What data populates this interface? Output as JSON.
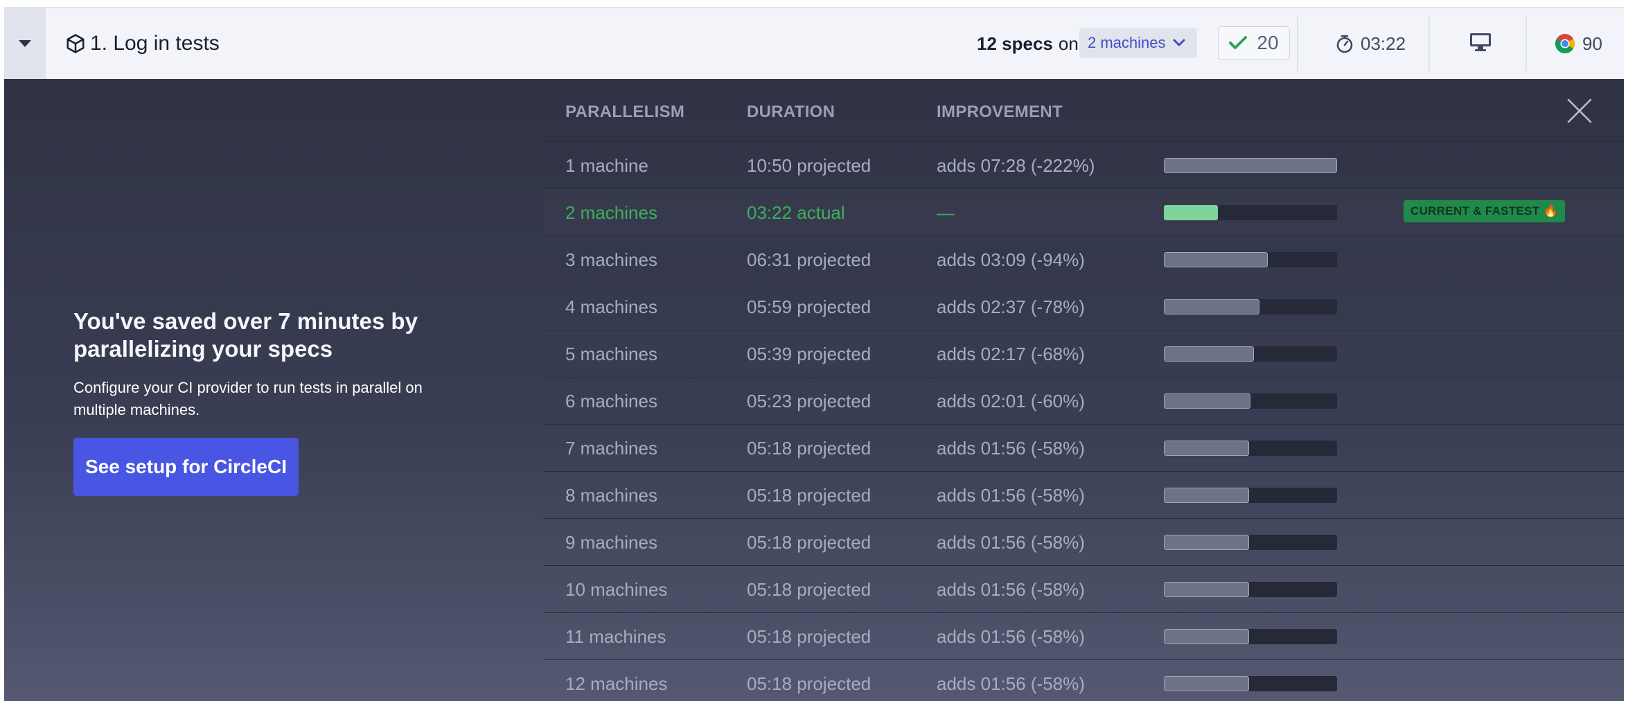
{
  "header": {
    "title": "1. Log in tests",
    "specs_count": "12 specs",
    "specs_on": "on",
    "machines_label": "2 machines",
    "passed_count": "20",
    "duration": "03:22",
    "browser_version": "90",
    "icons": {
      "toggle": "caret-down-icon",
      "spec": "cube-icon",
      "machines": "chevron-down-icon",
      "passed": "check-icon",
      "duration": "stopwatch-icon",
      "os": "monitor-icon",
      "browser": "chrome-icon"
    },
    "colors": {
      "accent": "#3e4fc2",
      "pass": "#2fa64f"
    }
  },
  "promo": {
    "heading": "You've saved over 7 minutes by parallelizing your specs",
    "text": "Configure your CI provider to run tests in parallel on multiple machines.",
    "button_label": "See setup for CircleCI",
    "button_color": "#4956e3"
  },
  "table": {
    "columns": [
      "PARALLELISM",
      "DURATION",
      "IMPROVEMENT"
    ],
    "close_icon": "close-icon",
    "badge": "CURRENT & FASTEST 🔥",
    "rows": [
      {
        "parallelism": "1 machine",
        "duration": "10:50 projected",
        "improvement": "adds 07:28 (-222%)",
        "bar_fraction": 1.0,
        "current": false
      },
      {
        "parallelism": "2 machines",
        "duration": "03:22 actual",
        "improvement": "—",
        "bar_fraction": 0.31,
        "current": true
      },
      {
        "parallelism": "3 machines",
        "duration": "06:31 projected",
        "improvement": "adds 03:09 (-94%)",
        "bar_fraction": 0.6,
        "current": false
      },
      {
        "parallelism": "4 machines",
        "duration": "05:59 projected",
        "improvement": "adds 02:37 (-78%)",
        "bar_fraction": 0.55,
        "current": false
      },
      {
        "parallelism": "5 machines",
        "duration": "05:39 projected",
        "improvement": "adds 02:17 (-68%)",
        "bar_fraction": 0.52,
        "current": false
      },
      {
        "parallelism": "6 machines",
        "duration": "05:23 projected",
        "improvement": "adds 02:01 (-60%)",
        "bar_fraction": 0.5,
        "current": false
      },
      {
        "parallelism": "7 machines",
        "duration": "05:18 projected",
        "improvement": "adds 01:56 (-58%)",
        "bar_fraction": 0.49,
        "current": false
      },
      {
        "parallelism": "8 machines",
        "duration": "05:18 projected",
        "improvement": "adds 01:56 (-58%)",
        "bar_fraction": 0.49,
        "current": false
      },
      {
        "parallelism": "9 machines",
        "duration": "05:18 projected",
        "improvement": "adds 01:56 (-58%)",
        "bar_fraction": 0.49,
        "current": false
      },
      {
        "parallelism": "10 machines",
        "duration": "05:18 projected",
        "improvement": "adds 01:56 (-58%)",
        "bar_fraction": 0.49,
        "current": false
      },
      {
        "parallelism": "11 machines",
        "duration": "05:18 projected",
        "improvement": "adds 01:56 (-58%)",
        "bar_fraction": 0.49,
        "current": false
      },
      {
        "parallelism": "12 machines",
        "duration": "05:18 projected",
        "improvement": "adds 01:56 (-58%)",
        "bar_fraction": 0.49,
        "current": false
      }
    ]
  }
}
